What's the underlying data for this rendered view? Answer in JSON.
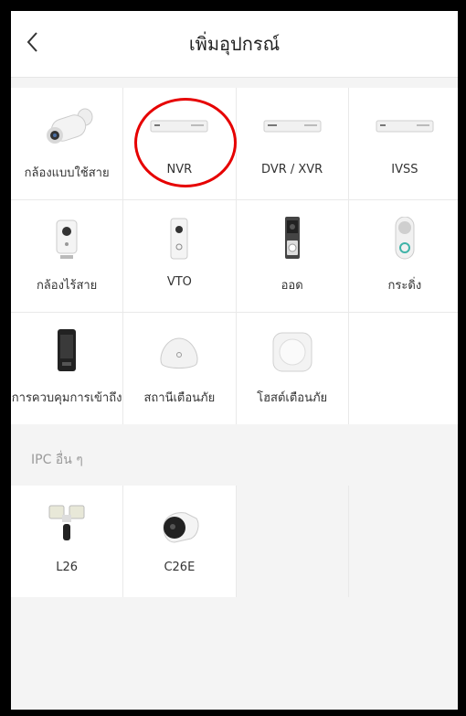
{
  "header": {
    "title": "เพิ่มอุปกรณ์"
  },
  "devices": [
    {
      "name": "wired-camera",
      "label": "กล้องแบบใช้สาย",
      "icon": "bullet-camera-icon"
    },
    {
      "name": "nvr",
      "label": "NVR",
      "icon": "nvr-recorder-icon"
    },
    {
      "name": "dvr-xvr",
      "label": "DVR / XVR",
      "icon": "dvr-recorder-icon"
    },
    {
      "name": "ivss",
      "label": "IVSS",
      "icon": "ivss-recorder-icon"
    },
    {
      "name": "wireless-camera",
      "label": "กล้องไร้สาย",
      "icon": "cube-camera-icon"
    },
    {
      "name": "vto",
      "label": "VTO",
      "icon": "intercom-icon"
    },
    {
      "name": "doorbell",
      "label": "ออด",
      "icon": "video-doorbell-icon"
    },
    {
      "name": "chime",
      "label": "กระดิ่ง",
      "icon": "chime-icon"
    },
    {
      "name": "access-control",
      "label": "การควบคุมการเข้าถึง",
      "icon": "access-terminal-icon"
    },
    {
      "name": "alarm-station",
      "label": "สถานีเตือนภัย",
      "icon": "alarm-hub-icon"
    },
    {
      "name": "alarm-host",
      "label": "โฮสต์เตือนภัย",
      "icon": "alarm-host-icon"
    }
  ],
  "other_section": {
    "label": "IPC อื่น ๆ"
  },
  "other_devices": [
    {
      "name": "l26",
      "label": "L26",
      "icon": "floodlight-camera-icon"
    },
    {
      "name": "c26e",
      "label": "C26E",
      "icon": "outdoor-camera-icon"
    }
  ],
  "highlight": {
    "color": "#e60000",
    "target": "NVR"
  }
}
